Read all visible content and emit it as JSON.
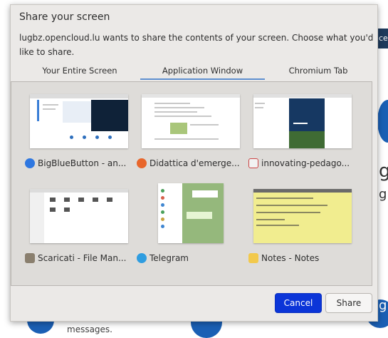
{
  "background": {
    "right_bar_text": "ced",
    "letter_1": "g",
    "letter_2": "g",
    "letter_3": "g",
    "messages": "messages."
  },
  "dialog": {
    "title": "Share your screen",
    "message": "lugbz.opencloud.lu wants to share the contents of your screen. Choose what you'd like to share.",
    "tabs": [
      {
        "label": "Your Entire Screen"
      },
      {
        "label": "Application Window",
        "active": true
      },
      {
        "label": "Chromium Tab"
      }
    ],
    "windows": [
      {
        "label": "BigBlueButton - an...",
        "icon": "bigbluebutton-icon"
      },
      {
        "label": "Didattica d'emerge...",
        "icon": "firefox-icon"
      },
      {
        "label": "innovating-pedago...",
        "icon": "pdf-viewer-icon"
      },
      {
        "label": "Scaricati - File Man...",
        "icon": "folder-icon"
      },
      {
        "label": "Telegram",
        "icon": "telegram-icon"
      },
      {
        "label": "Notes - Notes",
        "icon": "notes-folder-icon"
      }
    ],
    "buttons": {
      "cancel": "Cancel",
      "share": "Share"
    },
    "colors": {
      "cancel_bg": "#0b35d8",
      "tab_indicator": "#5e8fd0",
      "dialog_bg": "#ebe9e7"
    }
  }
}
